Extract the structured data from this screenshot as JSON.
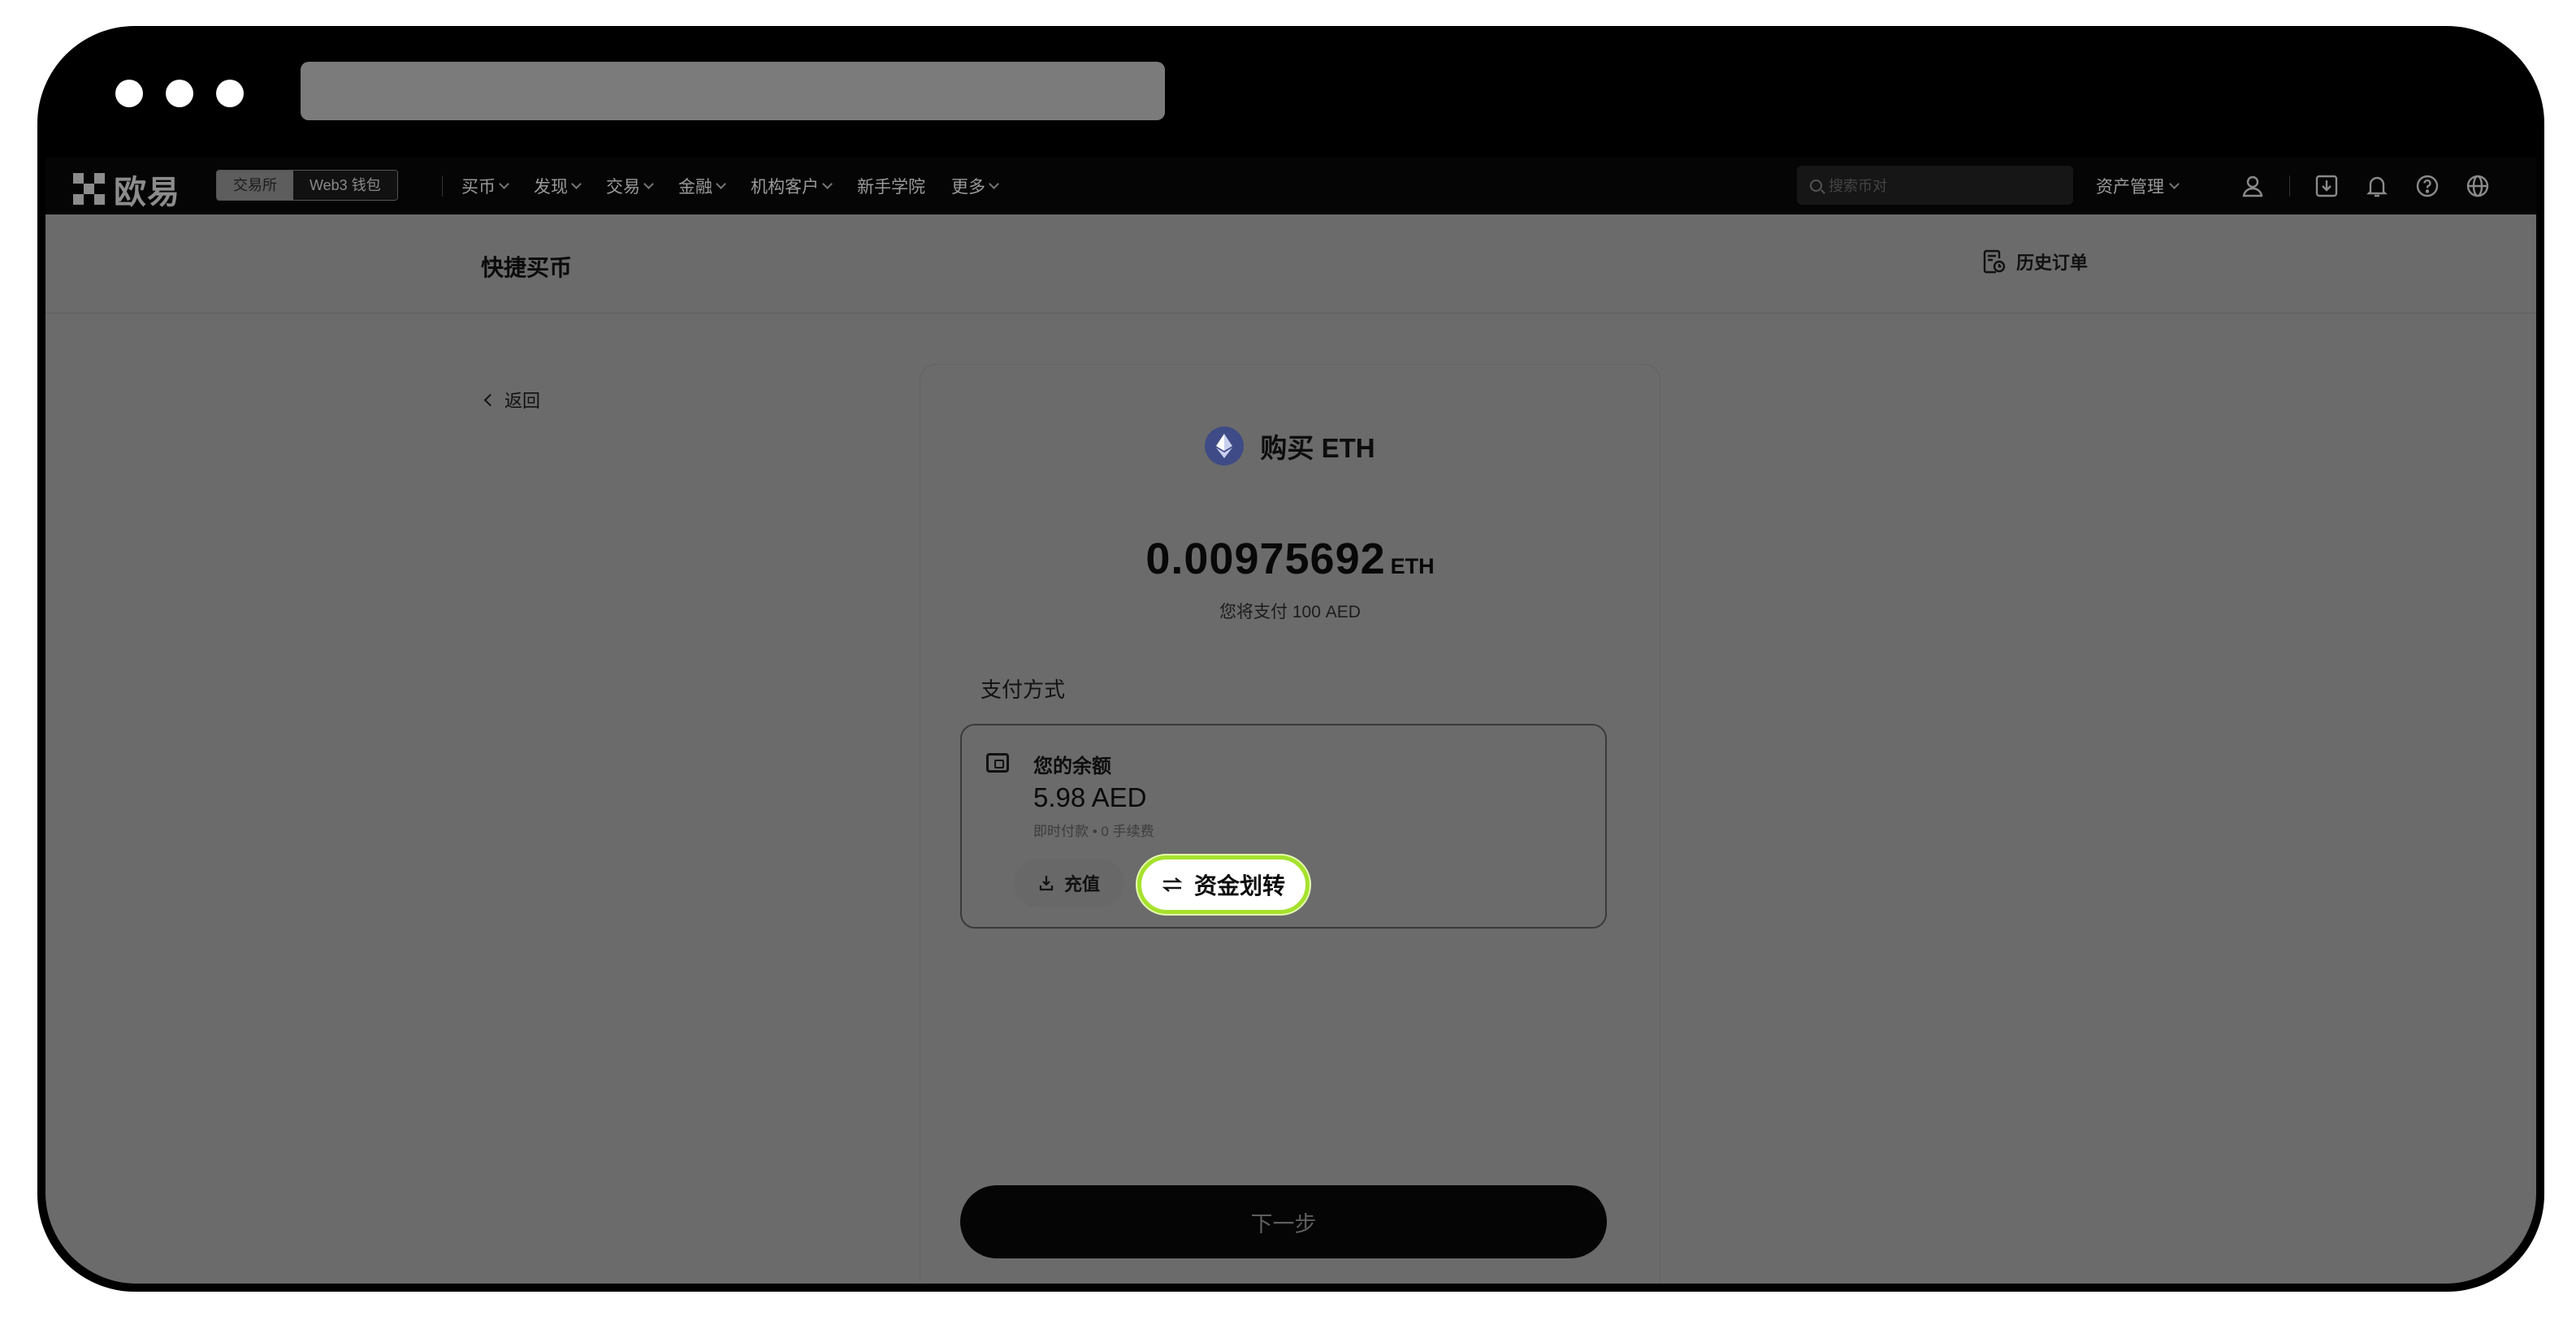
{
  "nav": {
    "logo_text": "欧易",
    "segment_exchange": "交易所",
    "segment_web3": "Web3 钱包",
    "menu": [
      "买币",
      "发现",
      "交易",
      "金融",
      "机构客户",
      "新手学院",
      "更多"
    ],
    "menu_has_chevron": [
      true,
      true,
      true,
      true,
      true,
      false,
      true
    ],
    "search_placeholder": "搜索币对",
    "asset_management": "资产管理"
  },
  "page": {
    "title": "快捷买币",
    "history_orders": "历史订单",
    "back": "返回"
  },
  "card": {
    "buy_title": "购买 ETH",
    "amount": "0.00975692",
    "amount_unit": "ETH",
    "pay_note": "您将支付 100 AED",
    "payment_method_label": "支付方式",
    "balance_title": "您的余额",
    "balance_value": "5.98 AED",
    "balance_sub": "即时付款 • 0 手续费",
    "deposit_label": "充值",
    "transfer_label": "资金划转",
    "next_label": "下一步"
  },
  "colors": {
    "highlight_ring": "#a6e22e",
    "overlay_bg": "#6b6b6b",
    "eth_logo": "#3f4b86"
  }
}
